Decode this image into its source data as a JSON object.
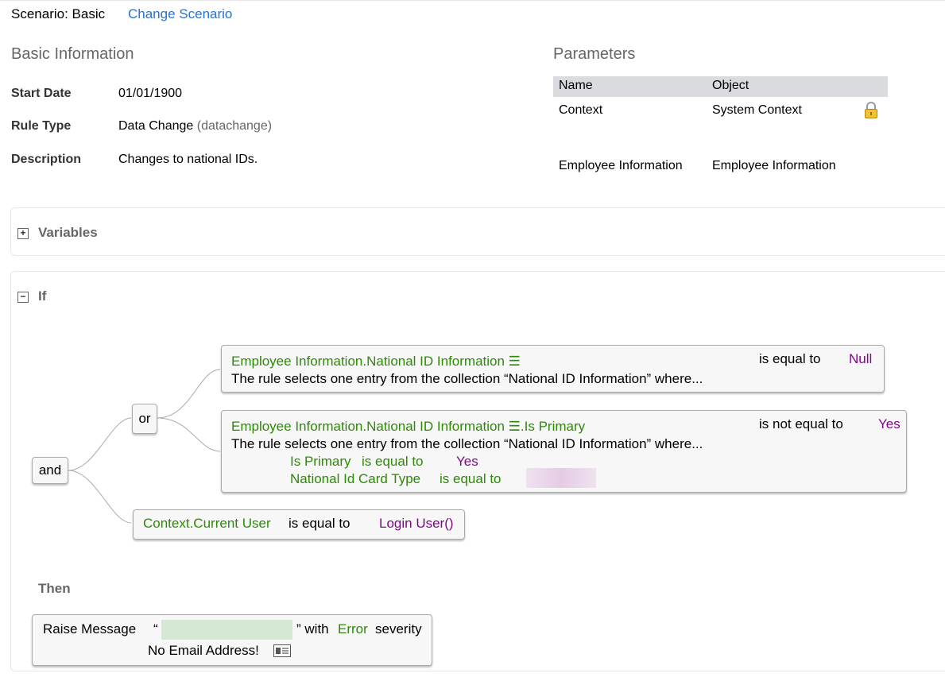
{
  "scenario": {
    "label": "Scenario: Basic",
    "change_link": "Change Scenario"
  },
  "basic_info": {
    "title": "Basic Information",
    "fields": [
      {
        "label": "Start Date",
        "value": "01/01/1900"
      },
      {
        "label": "Rule Type",
        "value": "Data Change",
        "value_suffix": "(datachange)"
      },
      {
        "label": "Description",
        "value": "Changes to national IDs."
      }
    ]
  },
  "parameters": {
    "title": "Parameters",
    "columns": [
      "Name",
      "Object"
    ],
    "rows": [
      {
        "name": "Context",
        "object": "System Context",
        "icon": "lock-icon"
      },
      {
        "name": "Employee Information",
        "object": "Employee Information"
      }
    ]
  },
  "variables": {
    "title": "Variables",
    "toggle": "+"
  },
  "if_section": {
    "title": "If",
    "toggle": "−",
    "and_label": "and",
    "or_label": "or",
    "cond1": {
      "field": "Employee Information.National ID Information ☰",
      "operator": "is equal to",
      "value": "Null",
      "description": "The rule selects one entry from the collection “National ID Information” where..."
    },
    "cond2": {
      "field": "Employee Information.National ID Information ☰.Is Primary",
      "operator": "is not equal to",
      "value": "Yes",
      "description": "The rule selects one entry from the collection “National ID Information” where...",
      "sub1_field": "Is Primary",
      "sub1_operator": "is equal to",
      "sub1_value": "Yes",
      "sub2_field": "National Id Card Type",
      "sub2_operator": "is equal to"
    },
    "cond3": {
      "field": "Context.Current User",
      "operator": "is equal to",
      "value": "Login User()"
    }
  },
  "then_section": {
    "title": "Then",
    "action": "Raise Message",
    "open_quote": "“",
    "close_quote": "” with",
    "severity": "Error",
    "severity_suffix": "severity",
    "message": "No Email Address!",
    "message_icon": "id-card-icon"
  },
  "colors": {
    "link": "#2b71c6",
    "field": "#2c8a06",
    "value": "#81068a",
    "header_bg": "#d9dbde"
  }
}
